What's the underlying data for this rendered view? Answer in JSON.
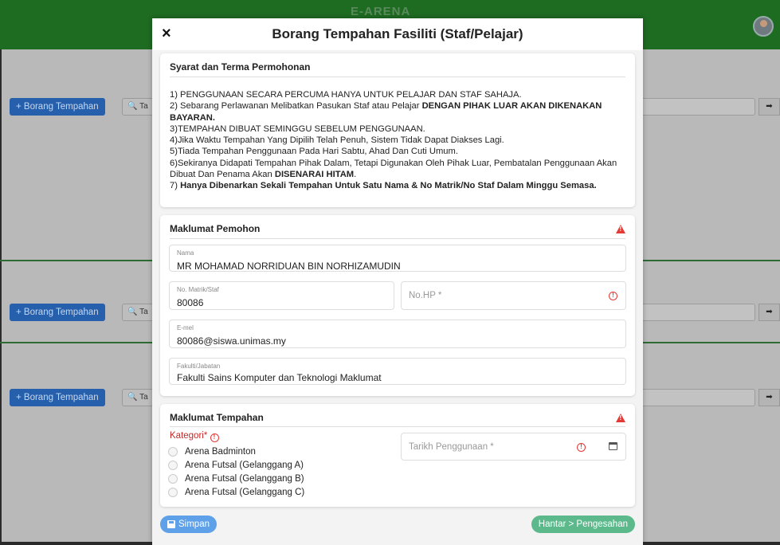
{
  "app": {
    "title": "E-ARENA"
  },
  "background": {
    "add_button_label": "+ Borang Tempahan",
    "search_stub": "Ta"
  },
  "modal": {
    "close_symbol": "×",
    "title": "Borang Tempahan Fasiliti (Staf/Pelajar)"
  },
  "terms": {
    "title": "Syarat dan Terma Permohonan",
    "item1": "1) PENGGUNAAN SECARA PERCUMA HANYA UNTUK PELAJAR DAN STAF SAHAJA.",
    "item2_plain": "2) Sebarang Perlawanan Melibatkan Pasukan Staf atau Pelajar ",
    "item2_bold": "DENGAN PIHAK LUAR AKAN DIKENAKAN BAYARAN.",
    "item3": "3)TEMPAHAN DIBUAT SEMINGGU SEBELUM PENGGUNAAN.",
    "item4": "4)Jika Waktu Tempahan Yang Dipilih Telah Penuh, Sistem Tidak Dapat Diakses Lagi.",
    "item5": "5)Tiada Tempahan Penggunaan Pada Hari Sabtu, Ahad Dan Cuti Umum.",
    "item6_plain": "6)Sekiranya Didapati Tempahan Pihak Dalam, Tetapi Digunakan Oleh Pihak Luar, Pembatalan Penggunaan Akan Dibuat Dan Penama Akan ",
    "item6_bold": "DISENARAI HITAM",
    "item6_end": ".",
    "item7_plain": "7) ",
    "item7_bold": "Hanya Dibenarkan Sekali Tempahan Untuk Satu Nama & No Matrik/No Staf Dalam Minggu Semasa."
  },
  "applicant": {
    "title": "Maklumat Pemohon",
    "name_label": "Nama",
    "name_value": "MR MOHAMAD NORRIDUAN BIN NORHIZAMUDIN",
    "matric_label": "No. Matrik/Staf",
    "matric_value": "80086",
    "phone_placeholder": "No.HP *",
    "email_label": "E-mel",
    "email_value": "80086@siswa.unimas.my",
    "faculty_label": "Fakulti/Jabatan",
    "faculty_value": "Fakulti Sains Komputer dan Teknologi Maklumat"
  },
  "booking": {
    "title": "Maklumat Tempahan",
    "category_label": "Kategori*",
    "categories": [
      "Arena Badminton",
      "Arena Futsal (Gelanggang A)",
      "Arena Futsal (Gelanggang B)",
      "Arena Futsal (Gelanggang C)"
    ],
    "date_placeholder": "Tarikh Penggunaan *"
  },
  "footer": {
    "save_label": "Simpan",
    "submit_label": "Hantar > Pengesahan"
  },
  "colors": {
    "topbar": "#1e6b22",
    "primary_button": "#2660ad",
    "error": "#e53935",
    "save_button": "#5ea1e8",
    "submit_button": "#5bb98b"
  }
}
